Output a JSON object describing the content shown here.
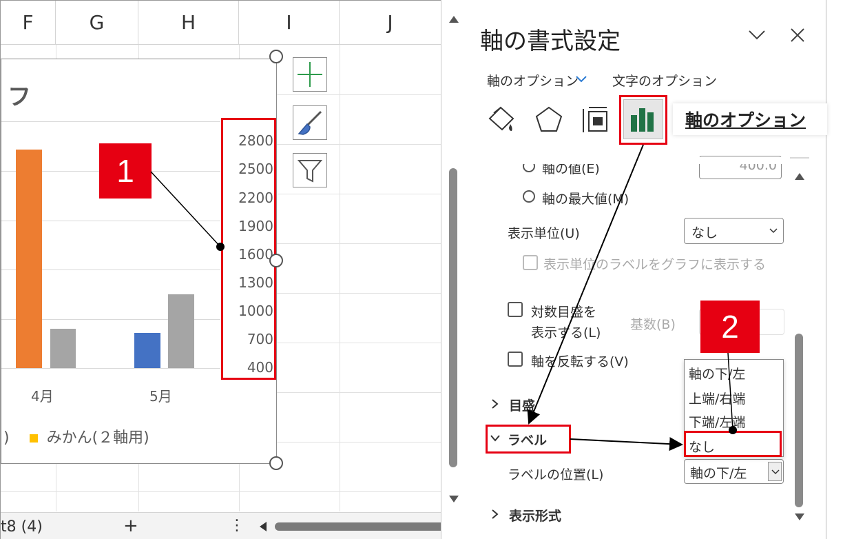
{
  "sheet": {
    "columns": [
      "F",
      "G",
      "H",
      "I",
      "J"
    ],
    "sheet_tab": "t8 (4)",
    "add_sheet": "+",
    "more": "⋮"
  },
  "chart": {
    "title_fragment": "フ",
    "axis_ticks": [
      "2800",
      "2500",
      "2200",
      "1900",
      "1600",
      "1300",
      "1000",
      "700",
      "400"
    ],
    "x_categories": [
      "4月",
      "5月"
    ],
    "legend_paren": ")",
    "legend_item": "みかん(２軸用)",
    "colors": {
      "orange": "#ed7d31",
      "gray": "#a5a5a5",
      "blue": "#4472c4",
      "yellow": "#ffc000"
    }
  },
  "panel": {
    "title": "軸の書式設定",
    "tab_axis_options": "軸のオプション",
    "tab_text_options": "文字のオプション",
    "callout": "軸のオプション",
    "axis_value_label": "軸の値(E)",
    "axis_value_input": "400.0",
    "axis_max_label": "軸の最大値(M)",
    "display_unit_label": "表示単位(U)",
    "display_unit_value": "なし",
    "display_unit_chart_label": "表示単位のラベルをグラフに表示する",
    "log_scale_line1": "対数目盛を",
    "log_scale_line2": "表示する(L)",
    "base_label": "基数(B)",
    "reverse_label": "軸を反転する(V)",
    "section_ticks": "目盛",
    "section_labels": "ラベル",
    "label_position_label": "ラベルの位置(L)",
    "label_position_value": "軸の下/左",
    "label_position_options": [
      "軸の下/左",
      "上端/右端",
      "下端/左端",
      "なし"
    ],
    "section_number": "表示形式"
  },
  "annotations": {
    "badge1": "1",
    "badge2": "2"
  }
}
